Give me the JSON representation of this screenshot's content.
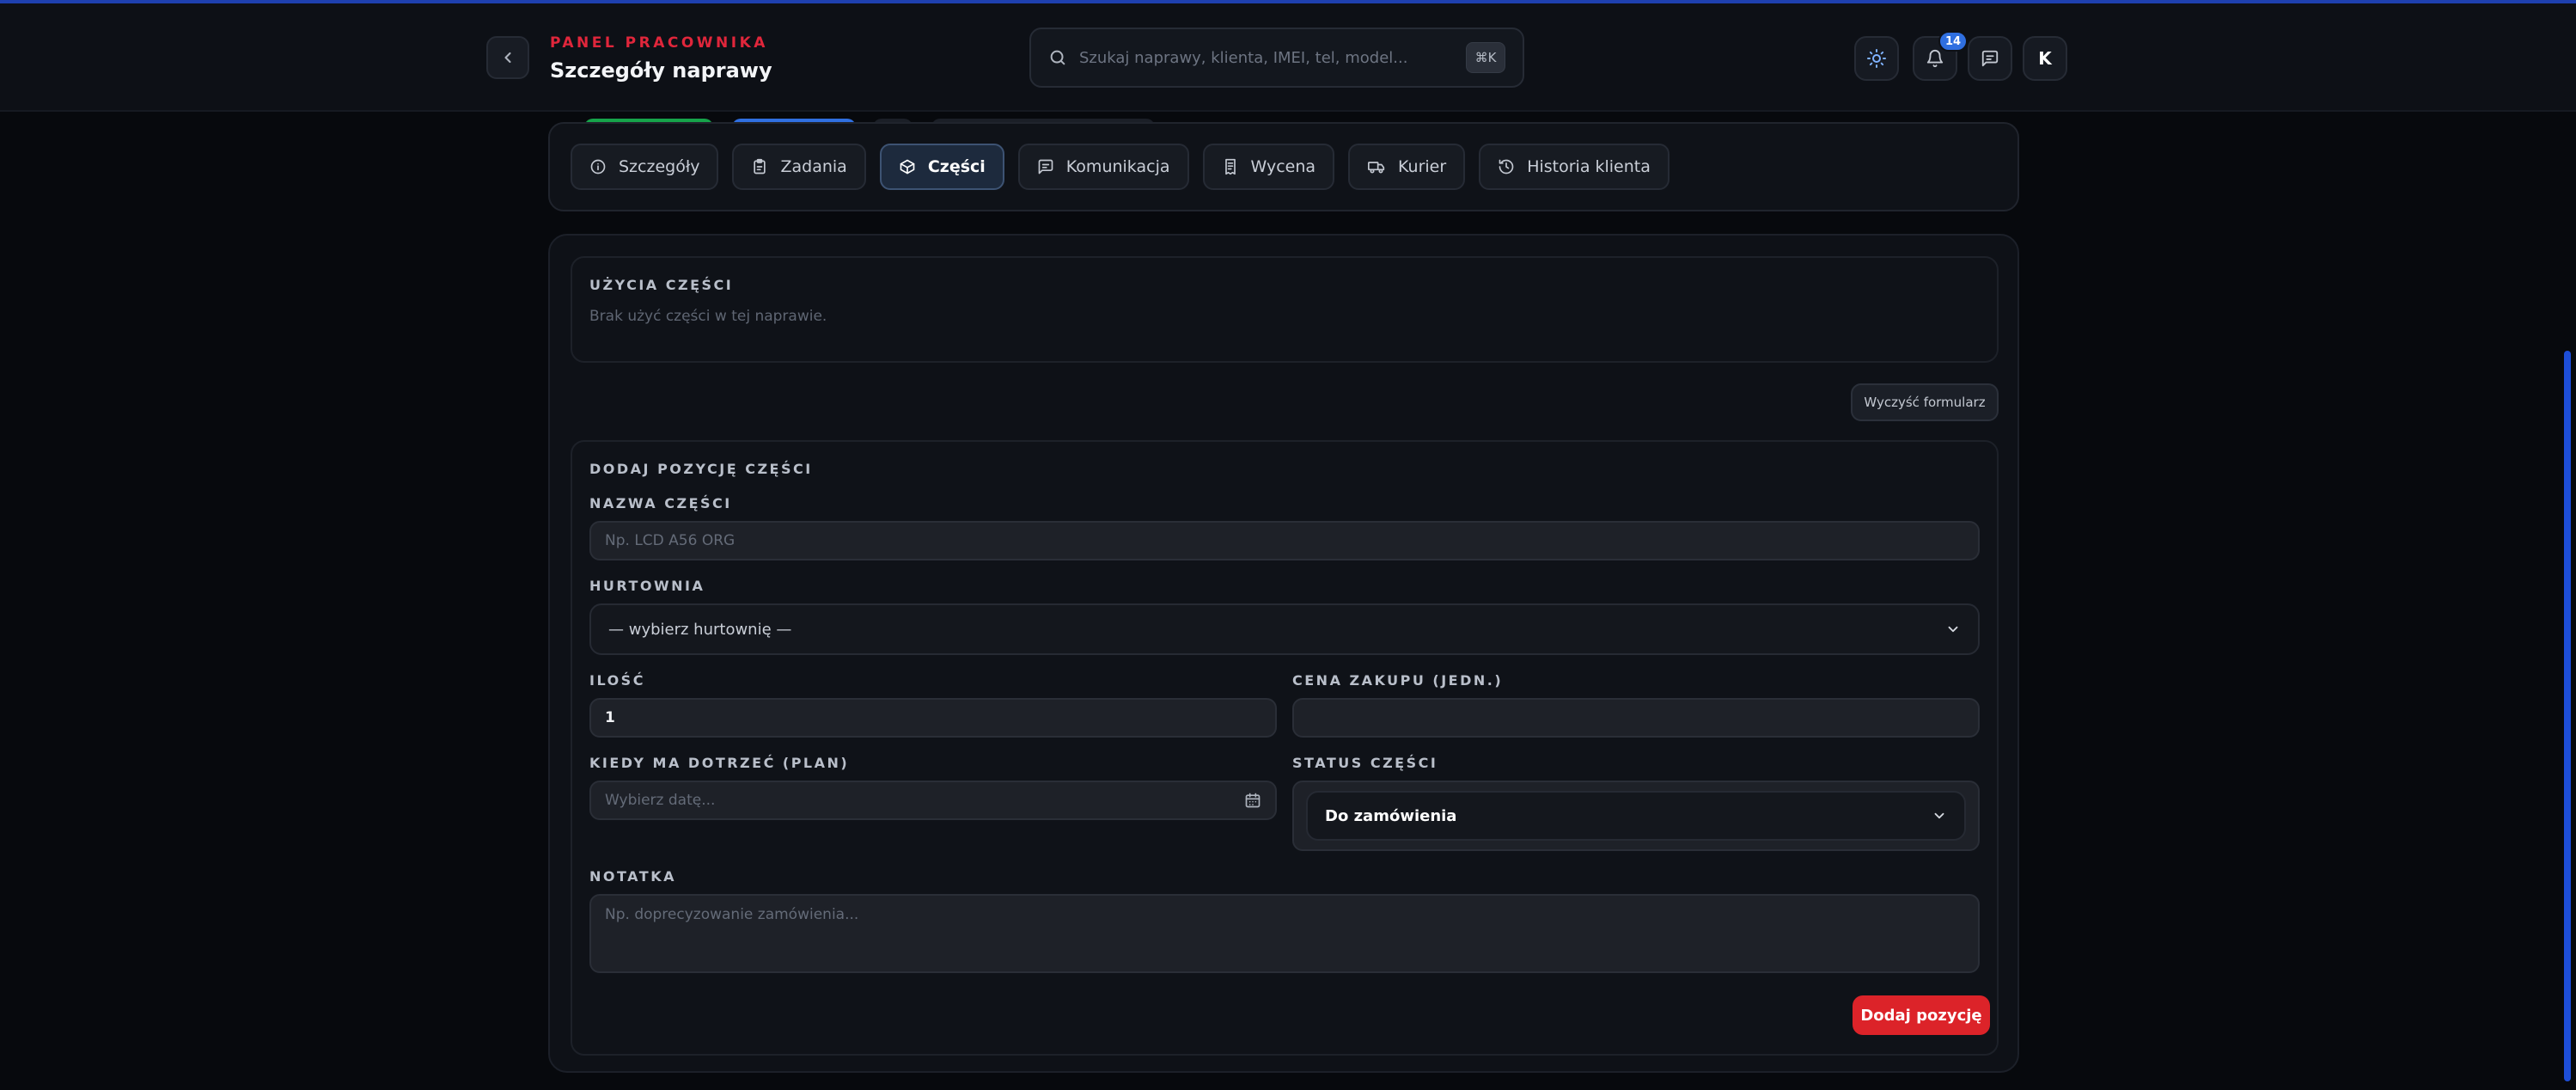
{
  "header": {
    "eyebrow": "PANEL PRACOWNIKA",
    "title": "Szczegóły naprawy",
    "search_placeholder": "Szukaj naprawy, klienta, IMEI, tel, model...",
    "search_shortcut": "⌘K",
    "notification_count": "14",
    "avatar_initial": "K"
  },
  "tabs": [
    {
      "label": "Szczegóły",
      "icon": "info-icon"
    },
    {
      "label": "Zadania",
      "icon": "clipboard-icon"
    },
    {
      "label": "Części",
      "icon": "package-icon",
      "active": true
    },
    {
      "label": "Komunikacja",
      "icon": "message-icon"
    },
    {
      "label": "Wycena",
      "icon": "receipt-icon"
    },
    {
      "label": "Kurier",
      "icon": "truck-icon"
    },
    {
      "label": "Historia klienta",
      "icon": "history-icon"
    }
  ],
  "usage": {
    "title": "UŻYCIA CZĘŚCI",
    "empty_text": "Brak użyć części w tej naprawie."
  },
  "clear_button": "Wyczyść formularz",
  "form": {
    "title": "DODAJ POZYCJĘ CZĘŚCI",
    "name_label": "NAZWA CZĘŚCI",
    "name_placeholder": "Np. LCD A56 ORG",
    "wholesaler_label": "HURTOWNIA",
    "wholesaler_value": "— wybierz hurtownię —",
    "qty_label": "ILOŚĆ",
    "qty_value": "1",
    "price_label": "CENA ZAKUPU (JEDN.)",
    "price_value": "",
    "eta_label": "KIEDY MA DOTRZEĆ (PLAN)",
    "eta_placeholder": "Wybierz datę...",
    "status_label": "STATUS CZĘŚCI",
    "status_value": "Do zamówienia",
    "note_label": "NOTATKA",
    "note_placeholder": "Np. doprecyzowanie zamówienia...",
    "submit_label": "Dodaj pozycję"
  },
  "colors": {
    "accent_red": "#dc2329",
    "eyebrow_red": "#e0263b",
    "badge_blue": "#2f6fe0",
    "background": "#07090d"
  }
}
